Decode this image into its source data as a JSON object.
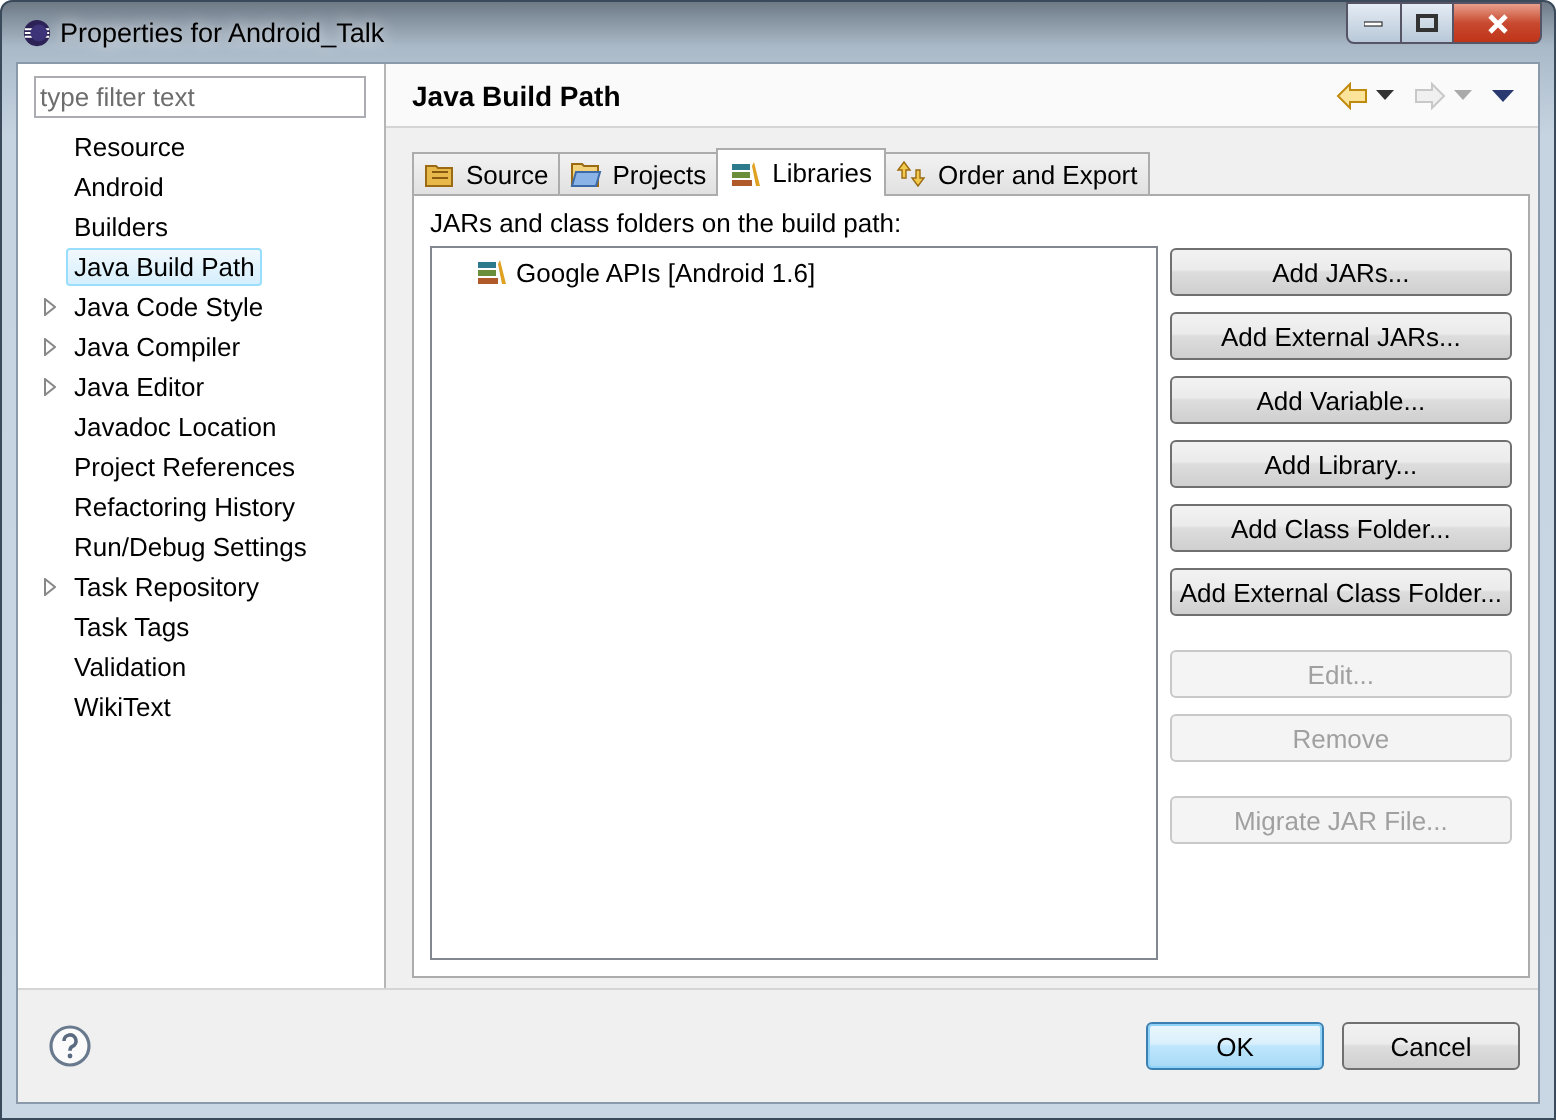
{
  "window": {
    "title": "Properties for Android_Talk"
  },
  "filter": {
    "placeholder": "type filter text"
  },
  "tree": {
    "items": [
      {
        "label": "Resource",
        "expandable": false,
        "selected": false
      },
      {
        "label": "Android",
        "expandable": false,
        "selected": false
      },
      {
        "label": "Builders",
        "expandable": false,
        "selected": false
      },
      {
        "label": "Java Build Path",
        "expandable": false,
        "selected": true
      },
      {
        "label": "Java Code Style",
        "expandable": true,
        "selected": false
      },
      {
        "label": "Java Compiler",
        "expandable": true,
        "selected": false
      },
      {
        "label": "Java Editor",
        "expandable": true,
        "selected": false
      },
      {
        "label": "Javadoc Location",
        "expandable": false,
        "selected": false
      },
      {
        "label": "Project References",
        "expandable": false,
        "selected": false
      },
      {
        "label": "Refactoring History",
        "expandable": false,
        "selected": false
      },
      {
        "label": "Run/Debug Settings",
        "expandable": false,
        "selected": false
      },
      {
        "label": "Task Repository",
        "expandable": true,
        "selected": false
      },
      {
        "label": "Task Tags",
        "expandable": false,
        "selected": false
      },
      {
        "label": "Validation",
        "expandable": false,
        "selected": false
      },
      {
        "label": "WikiText",
        "expandable": false,
        "selected": false
      }
    ]
  },
  "page": {
    "title": "Java Build Path"
  },
  "tabs": [
    {
      "label": "Source",
      "kind": "source",
      "selected": false
    },
    {
      "label": "Projects",
      "kind": "projects",
      "selected": false
    },
    {
      "label": "Libraries",
      "kind": "libraries",
      "selected": true
    },
    {
      "label": "Order and Export",
      "kind": "order",
      "selected": false
    }
  ],
  "libraries": {
    "caption": "JARs and class folders on the build path:",
    "entries": [
      {
        "label": "Google APIs [Android 1.6]"
      }
    ]
  },
  "side_button_groups": [
    {
      "buttons": [
        {
          "label": "Add JARs...",
          "disabled": false
        },
        {
          "label": "Add External JARs...",
          "disabled": false
        },
        {
          "label": "Add Variable...",
          "disabled": false
        },
        {
          "label": "Add Library...",
          "disabled": false
        },
        {
          "label": "Add Class Folder...",
          "disabled": false
        },
        {
          "label": "Add External Class Folder...",
          "disabled": false
        }
      ]
    },
    {
      "buttons": [
        {
          "label": "Edit...",
          "disabled": true
        },
        {
          "label": "Remove",
          "disabled": true
        }
      ]
    },
    {
      "buttons": [
        {
          "label": "Migrate JAR File...",
          "disabled": true
        }
      ]
    }
  ],
  "footer_buttons": [
    {
      "label": "OK",
      "default": true
    },
    {
      "label": "Cancel",
      "default": false
    }
  ]
}
